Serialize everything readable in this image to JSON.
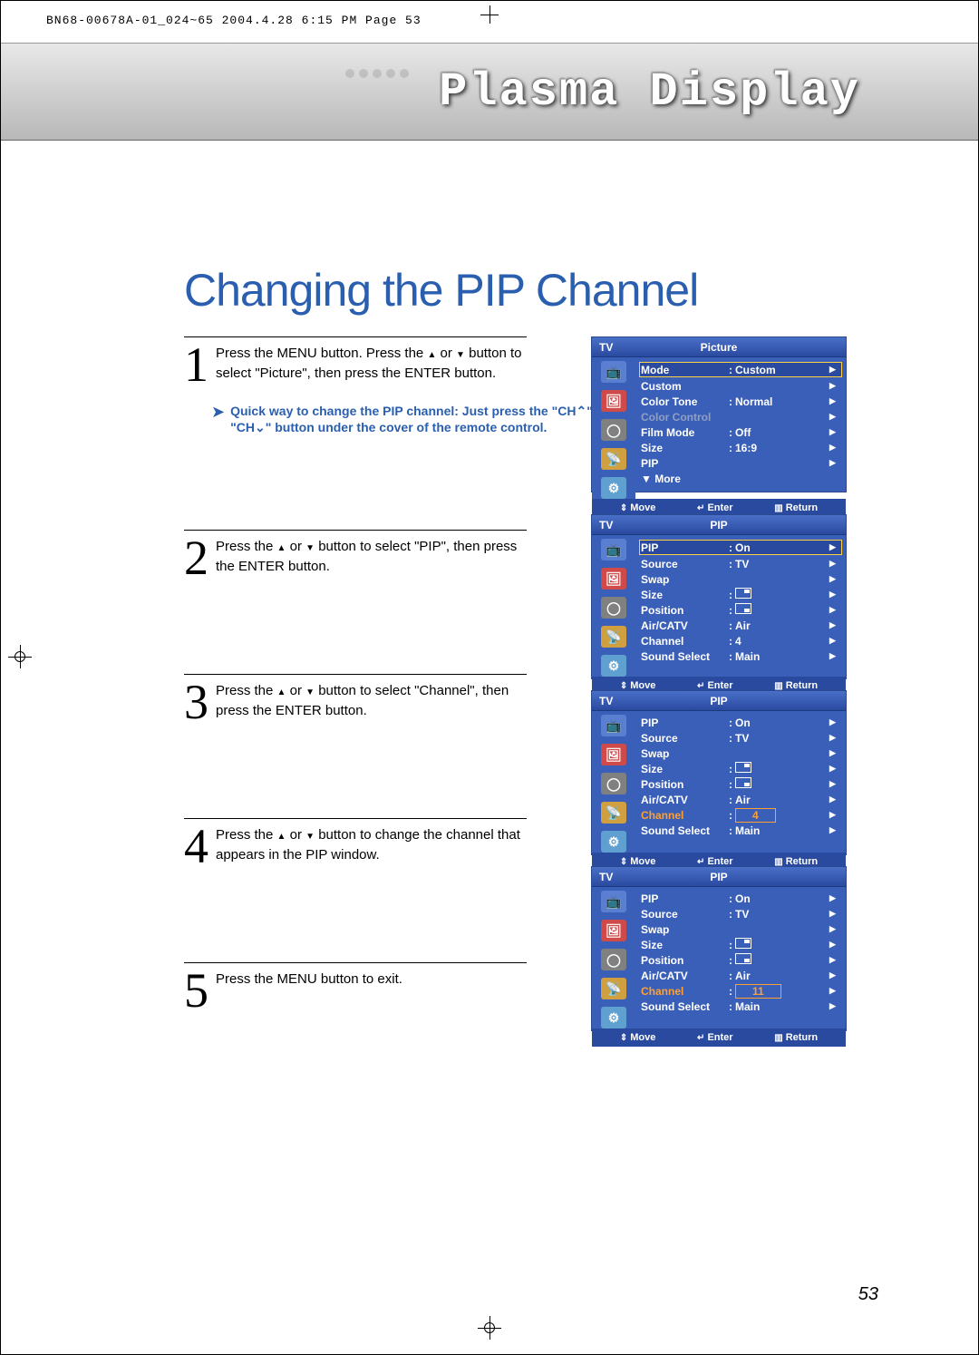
{
  "header_line": "BN68-00678A-01_024~65  2004.4.28  6:15 PM  Page 53",
  "banner_title": "Plasma Display",
  "chapter_title": "Changing the PIP Channel",
  "page_number": "53",
  "steps": [
    {
      "num": "1",
      "text_before": "Press the MENU button. Press the ",
      "text_mid": " or ",
      "text_after": " button to select \"Picture\", then press the ENTER button."
    },
    {
      "num": "2",
      "text_before": "Press the ",
      "text_mid": " or ",
      "text_after": " button to select \"PIP\", then press the ENTER button."
    },
    {
      "num": "3",
      "text_before": "Press the ",
      "text_mid": " or ",
      "text_after": " button to select \"Channel\", then press the ENTER button."
    },
    {
      "num": "4",
      "text_before": "Press the ",
      "text_mid": " or ",
      "text_after": " button to change the channel that appears in the PIP window."
    },
    {
      "num": "5",
      "text": "Press the MENU button to exit."
    }
  ],
  "tip": {
    "line1": "Quick way to change the PIP channel: Just press the \"CH",
    "line1_end": "\" or",
    "line2": "\"CH",
    "line2_end": "\" button under the cover of the remote control."
  },
  "osd": {
    "tv": "TV",
    "footer": {
      "move": "Move",
      "enter": "Enter",
      "return": "Return"
    },
    "screen1": {
      "title": "Picture",
      "rows": [
        {
          "label": "Mode",
          "value": "Custom",
          "hl": true
        },
        {
          "label": "Custom",
          "value": ""
        },
        {
          "label": "Color Tone",
          "value": "Normal"
        },
        {
          "label": "Color Control",
          "value": "",
          "grey": true
        },
        {
          "label": "Film Mode",
          "value": "Off"
        },
        {
          "label": "Size",
          "value": "16:9"
        },
        {
          "label": "PIP",
          "value": ""
        },
        {
          "label": "▼ More",
          "value": "",
          "nocaret": true
        }
      ]
    },
    "screen2": {
      "title": "PIP",
      "rows": [
        {
          "label": "PIP",
          "value": "On",
          "hl": true
        },
        {
          "label": "Source",
          "value": "TV"
        },
        {
          "label": "Swap",
          "value": ""
        },
        {
          "label": "Size",
          "value": "",
          "icon": "size"
        },
        {
          "label": "Position",
          "value": "",
          "icon": "pos"
        },
        {
          "label": "Air/CATV",
          "value": "Air"
        },
        {
          "label": "Channel",
          "value": "4"
        },
        {
          "label": "Sound Select",
          "value": "Main"
        }
      ]
    },
    "screen3": {
      "title": "PIP",
      "rows": [
        {
          "label": "PIP",
          "value": "On"
        },
        {
          "label": "Source",
          "value": "TV"
        },
        {
          "label": "Swap",
          "value": ""
        },
        {
          "label": "Size",
          "value": "",
          "icon": "size"
        },
        {
          "label": "Position",
          "value": "",
          "icon": "pos"
        },
        {
          "label": "Air/CATV",
          "value": "Air"
        },
        {
          "label": "Channel",
          "value": "4",
          "orange": true,
          "box": true
        },
        {
          "label": "Sound Select",
          "value": "Main"
        }
      ]
    },
    "screen4": {
      "title": "PIP",
      "rows": [
        {
          "label": "PIP",
          "value": "On"
        },
        {
          "label": "Source",
          "value": "TV"
        },
        {
          "label": "Swap",
          "value": ""
        },
        {
          "label": "Size",
          "value": "",
          "icon": "size"
        },
        {
          "label": "Position",
          "value": "",
          "icon": "pos"
        },
        {
          "label": "Air/CATV",
          "value": "Air"
        },
        {
          "label": "Channel",
          "value": "11",
          "orange": true,
          "box": true
        },
        {
          "label": "Sound Select",
          "value": "Main"
        }
      ]
    }
  }
}
